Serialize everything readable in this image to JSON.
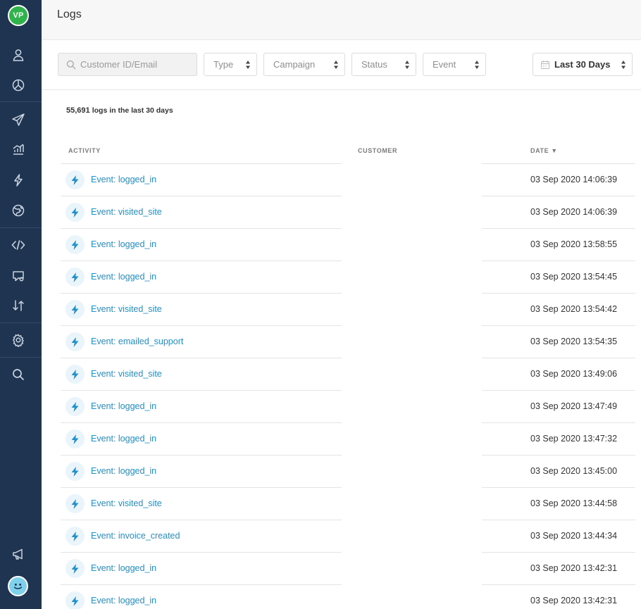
{
  "sidebar": {
    "avatar_initials": "VP",
    "avatar_color": "#2fb34a",
    "icons": [
      "person-icon",
      "segments-icon",
      "send-icon",
      "analytics-icon",
      "lightning-icon",
      "globe-icon",
      "code-icon",
      "chat-icon",
      "transfer-icon",
      "gear-icon",
      "search-icon",
      "megaphone-icon",
      "smiley-avatar-icon"
    ]
  },
  "header": {
    "title": "Logs"
  },
  "filters": {
    "search_placeholder": "Customer ID/Email",
    "type": "Type",
    "campaign": "Campaign",
    "status": "Status",
    "event": "Event",
    "date_range": "Last 30 Days"
  },
  "summary": {
    "count": "55,691",
    "suffix": "logs in the last 30 days"
  },
  "columns": {
    "activity": "ACTIVITY",
    "customer": "CUSTOMER",
    "date": "DATE",
    "sort_indicator": "▼"
  },
  "colors": {
    "sidebar_bg": "#1e3450",
    "link": "#2390c8"
  },
  "rows": [
    {
      "activity": "Event: logged_in",
      "date": "03 Sep 2020 14:06:39"
    },
    {
      "activity": "Event: visited_site",
      "date": "03 Sep 2020 14:06:39"
    },
    {
      "activity": "Event: logged_in",
      "date": "03 Sep 2020 13:58:55"
    },
    {
      "activity": "Event: logged_in",
      "date": "03 Sep 2020 13:54:45"
    },
    {
      "activity": "Event: visited_site",
      "date": "03 Sep 2020 13:54:42"
    },
    {
      "activity": "Event: emailed_support",
      "date": "03 Sep 2020 13:54:35"
    },
    {
      "activity": "Event: visited_site",
      "date": "03 Sep 2020 13:49:06"
    },
    {
      "activity": "Event: logged_in",
      "date": "03 Sep 2020 13:47:49"
    },
    {
      "activity": "Event: logged_in",
      "date": "03 Sep 2020 13:47:32"
    },
    {
      "activity": "Event: logged_in",
      "date": "03 Sep 2020 13:45:00"
    },
    {
      "activity": "Event: visited_site",
      "date": "03 Sep 2020 13:44:58"
    },
    {
      "activity": "Event: invoice_created",
      "date": "03 Sep 2020 13:44:34"
    },
    {
      "activity": "Event: logged_in",
      "date": "03 Sep 2020 13:42:31"
    },
    {
      "activity": "Event: logged_in",
      "date": "03 Sep 2020 13:42:31"
    }
  ]
}
